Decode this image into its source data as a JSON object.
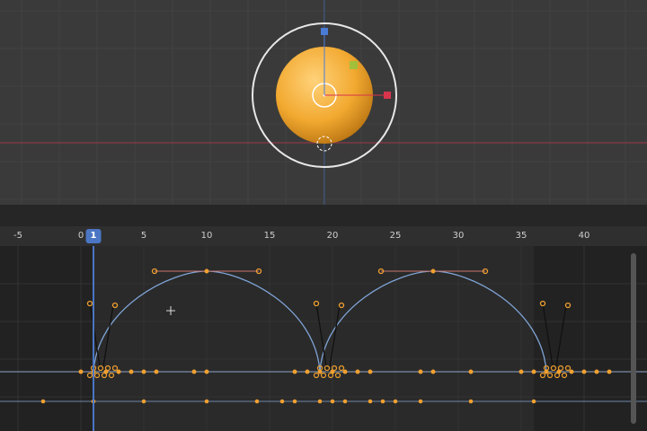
{
  "viewport": {
    "object_name": "sphere",
    "gizmo_colors": {
      "x": "#d8344c",
      "z": "#4a7cd6",
      "y": "#8ec63f",
      "ring": "#e8e8e8"
    }
  },
  "timeline": {
    "current_frame": "1",
    "ticks": [
      "-5",
      "0",
      "5",
      "10",
      "15",
      "20",
      "25",
      "30",
      "35",
      "40"
    ],
    "tick_values": [
      -5,
      0,
      5,
      10,
      15,
      20,
      25,
      30,
      35,
      40
    ],
    "range_end_frame": 36
  },
  "graph_editor": {
    "curve_color": "#7fa4d6",
    "key_color": "#f0a030",
    "bounce_keys": [
      1,
      10,
      19,
      28,
      37
    ],
    "scrubber_keys": [
      0,
      1,
      2,
      3,
      4,
      5,
      6,
      9,
      10,
      17,
      18,
      19,
      20,
      21,
      22,
      23,
      27,
      28,
      31,
      35,
      36,
      37,
      38,
      39,
      40,
      41,
      42
    ],
    "lower_keys": [
      -3,
      1,
      5,
      10,
      14,
      16,
      17,
      19,
      20,
      21,
      23,
      24,
      25,
      27,
      31,
      36
    ]
  },
  "colors": {
    "accent": "#4a76c4",
    "sphere": "#f2a930"
  }
}
